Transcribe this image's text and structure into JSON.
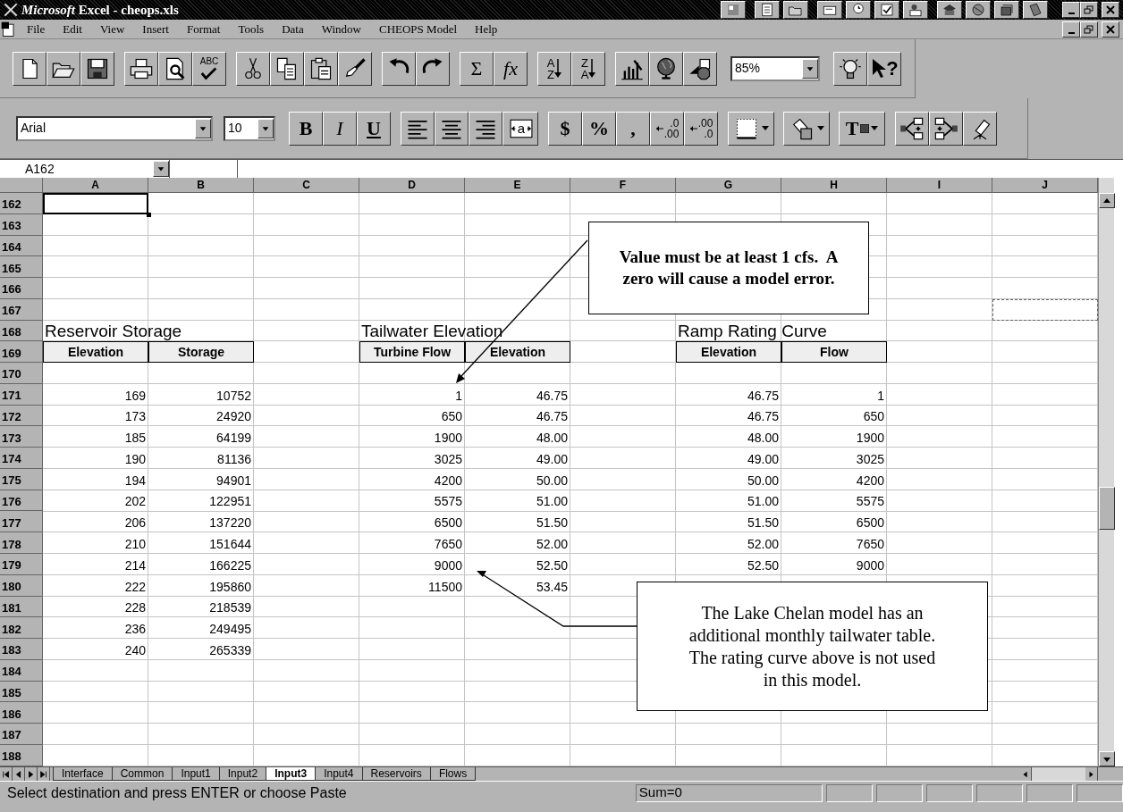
{
  "window": {
    "title": "*Microsoft* Excel - cheops.xls"
  },
  "menu": [
    "File",
    "Edit",
    "View",
    "Insert",
    "Format",
    "Tools",
    "Data",
    "Window",
    "CHEOPS Model",
    "Help"
  ],
  "toolbars": [
    {
      "groups": [
        {
          "buttons": [
            {
              "kind": "icon"
            },
            {
              "kind": "icon"
            },
            {
              "kind": "icon"
            }
          ]
        },
        {
          "buttons": [
            {
              "kind": "icon"
            },
            {
              "kind": "icon"
            },
            {
              "kind": "spell",
              "label": "ABC"
            }
          ]
        },
        {
          "buttons": [
            {
              "kind": "icon"
            },
            {
              "kind": "icon"
            },
            {
              "kind": "icon"
            },
            {
              "kind": "icon"
            }
          ]
        },
        {
          "buttons": [
            {
              "kind": "icon"
            },
            {
              "kind": "icon"
            }
          ]
        },
        {
          "buttons": [
            {
              "kind": "text",
              "label": "Σ"
            },
            {
              "kind": "italic",
              "label": "fx"
            }
          ]
        },
        {
          "buttons": [
            {
              "kind": "sort",
              "top": "A",
              "bottom": "Z"
            },
            {
              "kind": "sort",
              "top": "Z",
              "bottom": "A"
            }
          ]
        },
        {
          "buttons": [
            {
              "kind": "icon"
            },
            {
              "kind": "icon"
            },
            {
              "kind": "icon"
            }
          ]
        },
        {
          "buttons": [
            {
              "kind": "zoom-box",
              "value": "85%"
            }
          ]
        },
        {
          "buttons": [
            {
              "kind": "icon"
            },
            {
              "kind": "help",
              "label": "?"
            }
          ]
        }
      ]
    },
    {
      "groups": [
        {
          "buttons": [
            {
              "kind": "font-box",
              "value": "Arial"
            },
            {
              "kind": "size-box",
              "value": "10"
            }
          ]
        },
        {
          "buttons": [
            {
              "kind": "bold",
              "label": "B"
            },
            {
              "kind": "italic",
              "label": "I"
            },
            {
              "kind": "underline",
              "label": "U"
            }
          ]
        },
        {
          "buttons": [
            {
              "kind": "icon"
            },
            {
              "kind": "icon"
            },
            {
              "kind": "icon"
            },
            {
              "kind": "merge",
              "label": "a"
            }
          ]
        },
        {
          "buttons": [
            {
              "kind": "bold",
              "label": "$"
            },
            {
              "kind": "bold",
              "label": "%"
            },
            {
              "kind": "bold",
              "label": ","
            },
            {
              "kind": "decimal",
              "top": ".0",
              "bottom": ".00"
            },
            {
              "kind": "decimal",
              "top": ".00",
              "bottom": ".0"
            }
          ]
        },
        {
          "buttons": [
            {
              "kind": "drop-icon"
            },
            {
              "kind": "drop-icon"
            },
            {
              "kind": "font-color",
              "label": "T"
            }
          ]
        },
        {
          "buttons": [
            {
              "kind": "icon"
            },
            {
              "kind": "icon"
            },
            {
              "kind": "icon"
            }
          ]
        }
      ]
    }
  ],
  "formula_bar": {
    "name_box": "A162"
  },
  "sheet": {
    "columns": [
      "A",
      "B",
      "C",
      "D",
      "E",
      "F",
      "G",
      "H",
      "I",
      "J"
    ],
    "rows": [
      {
        "number": "162",
        "cells": [
          {
            "kind": "selected"
          }
        ]
      },
      {
        "number": "163"
      },
      {
        "number": "164"
      },
      {
        "number": "165"
      },
      {
        "number": "166"
      },
      {
        "number": "167",
        "cells": [
          null,
          null,
          null,
          null,
          null,
          null,
          null,
          null,
          null,
          {
            "kind": "marquee"
          }
        ]
      },
      {
        "number": "168",
        "cells": [
          {
            "kind": "title",
            "text": "Reservoir Storage"
          },
          null,
          null,
          {
            "kind": "title",
            "text": "Tailwater Elevation"
          },
          null,
          null,
          {
            "kind": "title",
            "text": "Ramp Rating Curve"
          }
        ]
      },
      {
        "number": "169",
        "cells": [
          {
            "kind": "header",
            "text": "Elevation"
          },
          {
            "kind": "header",
            "text": "Storage"
          },
          null,
          {
            "kind": "header",
            "text": "Turbine Flow"
          },
          {
            "kind": "header",
            "text": "Elevation"
          },
          null,
          {
            "kind": "header",
            "text": "Elevation"
          },
          {
            "kind": "header",
            "text": "Flow"
          }
        ]
      },
      {
        "number": "170"
      },
      {
        "number": "171",
        "cells": [
          {
            "kind": "number",
            "text": "169"
          },
          {
            "kind": "number",
            "text": "10752"
          },
          null,
          {
            "kind": "number",
            "text": "1"
          },
          {
            "kind": "number",
            "text": "46.75"
          },
          null,
          {
            "kind": "number",
            "text": "46.75"
          },
          {
            "kind": "number",
            "text": "1"
          }
        ]
      },
      {
        "number": "172",
        "cells": [
          {
            "kind": "number",
            "text": "173"
          },
          {
            "kind": "number",
            "text": "24920"
          },
          null,
          {
            "kind": "number",
            "text": "650"
          },
          {
            "kind": "number",
            "text": "46.75"
          },
          null,
          {
            "kind": "number",
            "text": "46.75"
          },
          {
            "kind": "number",
            "text": "650"
          }
        ]
      },
      {
        "number": "173",
        "cells": [
          {
            "kind": "number",
            "text": "185"
          },
          {
            "kind": "number",
            "text": "64199"
          },
          null,
          {
            "kind": "number",
            "text": "1900"
          },
          {
            "kind": "number",
            "text": "48.00"
          },
          null,
          {
            "kind": "number",
            "text": "48.00"
          },
          {
            "kind": "number",
            "text": "1900"
          }
        ]
      },
      {
        "number": "174",
        "cells": [
          {
            "kind": "number",
            "text": "190"
          },
          {
            "kind": "number",
            "text": "81136"
          },
          null,
          {
            "kind": "number",
            "text": "3025"
          },
          {
            "kind": "number",
            "text": "49.00"
          },
          null,
          {
            "kind": "number",
            "text": "49.00"
          },
          {
            "kind": "number",
            "text": "3025"
          }
        ]
      },
      {
        "number": "175",
        "cells": [
          {
            "kind": "number",
            "text": "194"
          },
          {
            "kind": "number",
            "text": "94901"
          },
          null,
          {
            "kind": "number",
            "text": "4200"
          },
          {
            "kind": "number",
            "text": "50.00"
          },
          null,
          {
            "kind": "number",
            "text": "50.00"
          },
          {
            "kind": "number",
            "text": "4200"
          }
        ]
      },
      {
        "number": "176",
        "cells": [
          {
            "kind": "number",
            "text": "202"
          },
          {
            "kind": "number",
            "text": "122951"
          },
          null,
          {
            "kind": "number",
            "text": "5575"
          },
          {
            "kind": "number",
            "text": "51.00"
          },
          null,
          {
            "kind": "number",
            "text": "51.00"
          },
          {
            "kind": "number",
            "text": "5575"
          }
        ]
      },
      {
        "number": "177",
        "cells": [
          {
            "kind": "number",
            "text": "206"
          },
          {
            "kind": "number",
            "text": "137220"
          },
          null,
          {
            "kind": "number",
            "text": "6500"
          },
          {
            "kind": "number",
            "text": "51.50"
          },
          null,
          {
            "kind": "number",
            "text": "51.50"
          },
          {
            "kind": "number",
            "text": "6500"
          }
        ]
      },
      {
        "number": "178",
        "cells": [
          {
            "kind": "number",
            "text": "210"
          },
          {
            "kind": "number",
            "text": "151644"
          },
          null,
          {
            "kind": "number",
            "text": "7650"
          },
          {
            "kind": "number",
            "text": "52.00"
          },
          null,
          {
            "kind": "number",
            "text": "52.00"
          },
          {
            "kind": "number",
            "text": "7650"
          }
        ]
      },
      {
        "number": "179",
        "cells": [
          {
            "kind": "number",
            "text": "214"
          },
          {
            "kind": "number",
            "text": "166225"
          },
          null,
          {
            "kind": "number",
            "text": "9000"
          },
          {
            "kind": "number",
            "text": "52.50"
          },
          null,
          {
            "kind": "number",
            "text": "52.50"
          },
          {
            "kind": "number",
            "text": "9000"
          }
        ]
      },
      {
        "number": "180",
        "cells": [
          {
            "kind": "number",
            "text": "222"
          },
          {
            "kind": "number",
            "text": "195860"
          },
          null,
          {
            "kind": "number",
            "text": "11500"
          },
          {
            "kind": "number",
            "text": "53.45"
          }
        ]
      },
      {
        "number": "181",
        "cells": [
          {
            "kind": "number",
            "text": "228"
          },
          {
            "kind": "number",
            "text": "218539"
          }
        ]
      },
      {
        "number": "182",
        "cells": [
          {
            "kind": "number",
            "text": "236"
          },
          {
            "kind": "number",
            "text": "249495"
          }
        ]
      },
      {
        "number": "183",
        "cells": [
          {
            "kind": "number",
            "text": "240"
          },
          {
            "kind": "number",
            "text": "265339"
          }
        ]
      },
      {
        "number": "184"
      },
      {
        "number": "185"
      },
      {
        "number": "186"
      },
      {
        "number": "187"
      },
      {
        "number": "188"
      }
    ]
  },
  "callouts": [
    {
      "text": "Value must be at least 1 cfs.  A zero will cause a model error.",
      "bold": true
    },
    {
      "text": "The Lake Chelan model has an additional monthly tailwater table.  The rating curve above is not used in this model.",
      "bold": false
    }
  ],
  "sheet_tabs": [
    {
      "label": "Interface",
      "selected": false
    },
    {
      "label": "Common",
      "selected": false
    },
    {
      "label": "Input1",
      "selected": false
    },
    {
      "label": "Input2",
      "selected": false
    },
    {
      "label": "Input3",
      "selected": true
    },
    {
      "label": "Input4",
      "selected": false
    },
    {
      "label": "Reservoirs",
      "selected": false
    },
    {
      "label": "Flows",
      "selected": false
    }
  ],
  "status_bar": {
    "message": "Select destination and press ENTER or choose Paste",
    "sum": "Sum=0"
  }
}
